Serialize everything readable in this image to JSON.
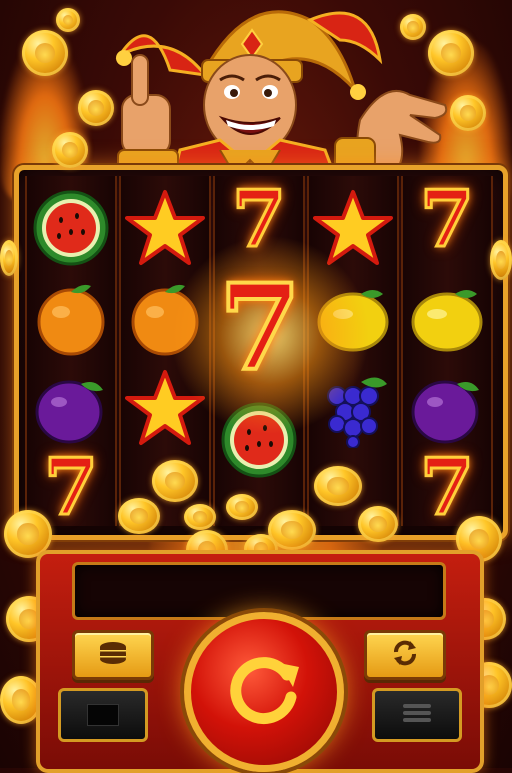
{
  "game": {
    "character": "jester",
    "reels": [
      [
        "watermelon",
        "orange",
        "plum",
        "seven"
      ],
      [
        "star",
        "orange",
        "star"
      ],
      [
        "seven",
        "seven-big",
        "watermelon"
      ],
      [
        "star",
        "lemon",
        "grapes"
      ],
      [
        "seven",
        "lemon",
        "plum",
        "seven"
      ]
    ],
    "display_text": ""
  },
  "controls": {
    "bet_icon": "coin-stack-icon",
    "autoplay_icon": "refresh-icon",
    "spin_icon": "spin-arrow-icon",
    "menu_icon": "menu-icon",
    "info_icon": "square-icon"
  },
  "colors": {
    "frame_gold": "#e8a22a",
    "panel_red": "#c41e0f",
    "seven_red": "#e42014"
  }
}
